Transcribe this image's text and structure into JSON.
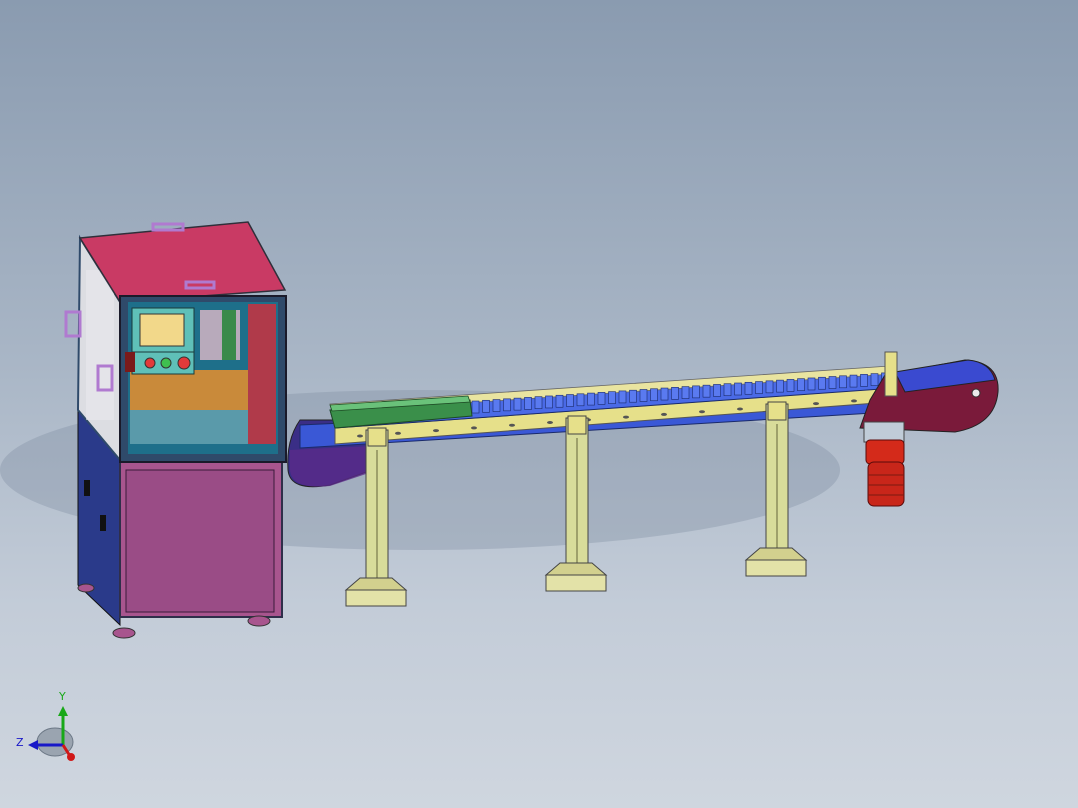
{
  "viewport": {
    "colors": {
      "bg_top": "#8a9bb0",
      "bg_bottom": "#cfd6df"
    }
  },
  "model": {
    "cabinet": {
      "top_color": "#c93a64",
      "side_color": "#e0e0e4",
      "base_color": "#a8558e",
      "frame_color": "#2f4a6a",
      "handle_color": "#b07ad0"
    },
    "hmi_panel": {
      "screen_color": "#f2d88a",
      "button_colors": [
        "#e23a3a",
        "#3fbf4f",
        "#e23a3a"
      ]
    },
    "conveyor": {
      "rail_color": "#e6e08a",
      "belt_color": "#3a58d6",
      "end_cap_color": "#7a1a3a",
      "guide_color": "#3a8f4a"
    },
    "supports": {
      "color": "#d8dc9a",
      "count": 3
    },
    "motor": {
      "color": "#d42a1a"
    }
  },
  "triad": {
    "x_label": "",
    "y_label": "Y",
    "z_label": "Z",
    "colors": {
      "x": "#d01818",
      "y": "#18a818",
      "z": "#1818c8"
    }
  }
}
